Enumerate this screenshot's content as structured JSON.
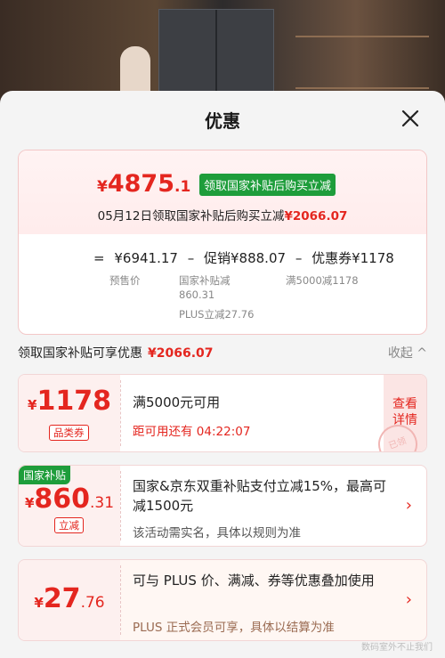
{
  "sheet": {
    "title": "优惠"
  },
  "summary": {
    "final_currency": "¥",
    "final_int": "4875",
    "final_dec": ".1",
    "badge": "领取国家补贴后购买立减",
    "note_prefix": "05月12日领取国家补贴后购买立减",
    "note_amount": "¥2066.07",
    "formula": {
      "eq": "=",
      "presale": "¥6941.17",
      "minus1": "–",
      "promo": "促销¥888.07",
      "minus2": "–",
      "coupon": "优惠券¥1178"
    },
    "presale_label": "预售价",
    "promo_sub1": "国家补贴减",
    "promo_sub2": "860.31",
    "promo_sub3": "PLUS立减27.76",
    "coupon_sub": "满5000减1178"
  },
  "section": {
    "label": "领取国家补贴可享优惠",
    "amount": "¥2066.07",
    "toggle": "收起 ^"
  },
  "cards": [
    {
      "currency": "¥",
      "int": "1178",
      "dec": "",
      "pill": "品类券",
      "title": "满5000元可用",
      "sub": "距可用还有 04:22:07",
      "action": "查看\n详情",
      "stamp": "已领"
    },
    {
      "corner": "国家补贴",
      "currency": "¥",
      "int": "860",
      "dec": ".31",
      "pill": "立减",
      "title": "国家&京东双重补贴支付立减15%，最高可减1500元",
      "sub": "该活动需实名，具体以规则为准"
    },
    {
      "currency": "¥",
      "int": "27",
      "dec": ".76",
      "title": "可与 PLUS 价、满减、券等优惠叠加使用",
      "sub": "PLUS 正式会员可享，具体以结算为准"
    }
  ],
  "watermark": "数码室外不止我们"
}
